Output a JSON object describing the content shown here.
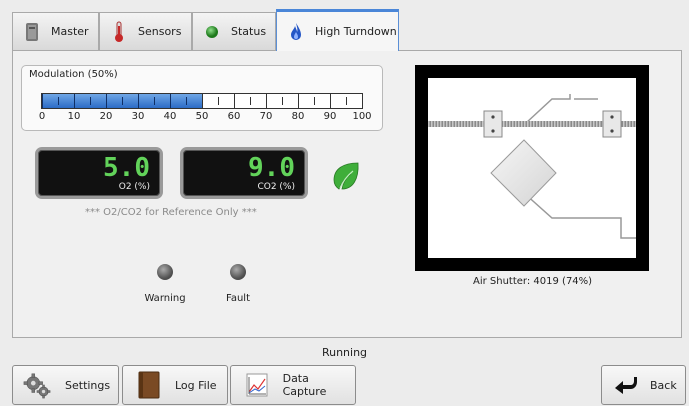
{
  "tabs": [
    {
      "label": "Master",
      "icon": "server-icon"
    },
    {
      "label": "Sensors",
      "icon": "thermometer-icon"
    },
    {
      "label": "Status",
      "icon": "status-led-icon"
    },
    {
      "label": "High Turndown",
      "icon": "flame-icon",
      "active": true
    }
  ],
  "modulation": {
    "title": "Modulation (50%)",
    "value_percent": 50,
    "scale": [
      "0",
      "10",
      "20",
      "30",
      "40",
      "50",
      "60",
      "70",
      "80",
      "90",
      "100"
    ]
  },
  "o2": {
    "value": "5.0",
    "unit": "O2 (%)"
  },
  "co2": {
    "value": "9.0",
    "unit": "CO2 (%)"
  },
  "reference_note": "*** O2/CO2 for Reference Only ***",
  "indicators": [
    {
      "label": "Warning",
      "state": "off"
    },
    {
      "label": "Fault",
      "state": "off"
    }
  ],
  "air_shutter": {
    "label": "Air Shutter: 4019 (74%)",
    "percent": 74
  },
  "status_text": "Running",
  "buttons": {
    "settings": "Settings",
    "log_file": "Log File",
    "data_capture": "Data Capture",
    "back": "Back"
  },
  "colors": {
    "readout_green": "#62d35a",
    "tab_accent": "#4a86d8",
    "bar_fill": "#2c6cc6",
    "leaf_green": "#3fae3a"
  }
}
